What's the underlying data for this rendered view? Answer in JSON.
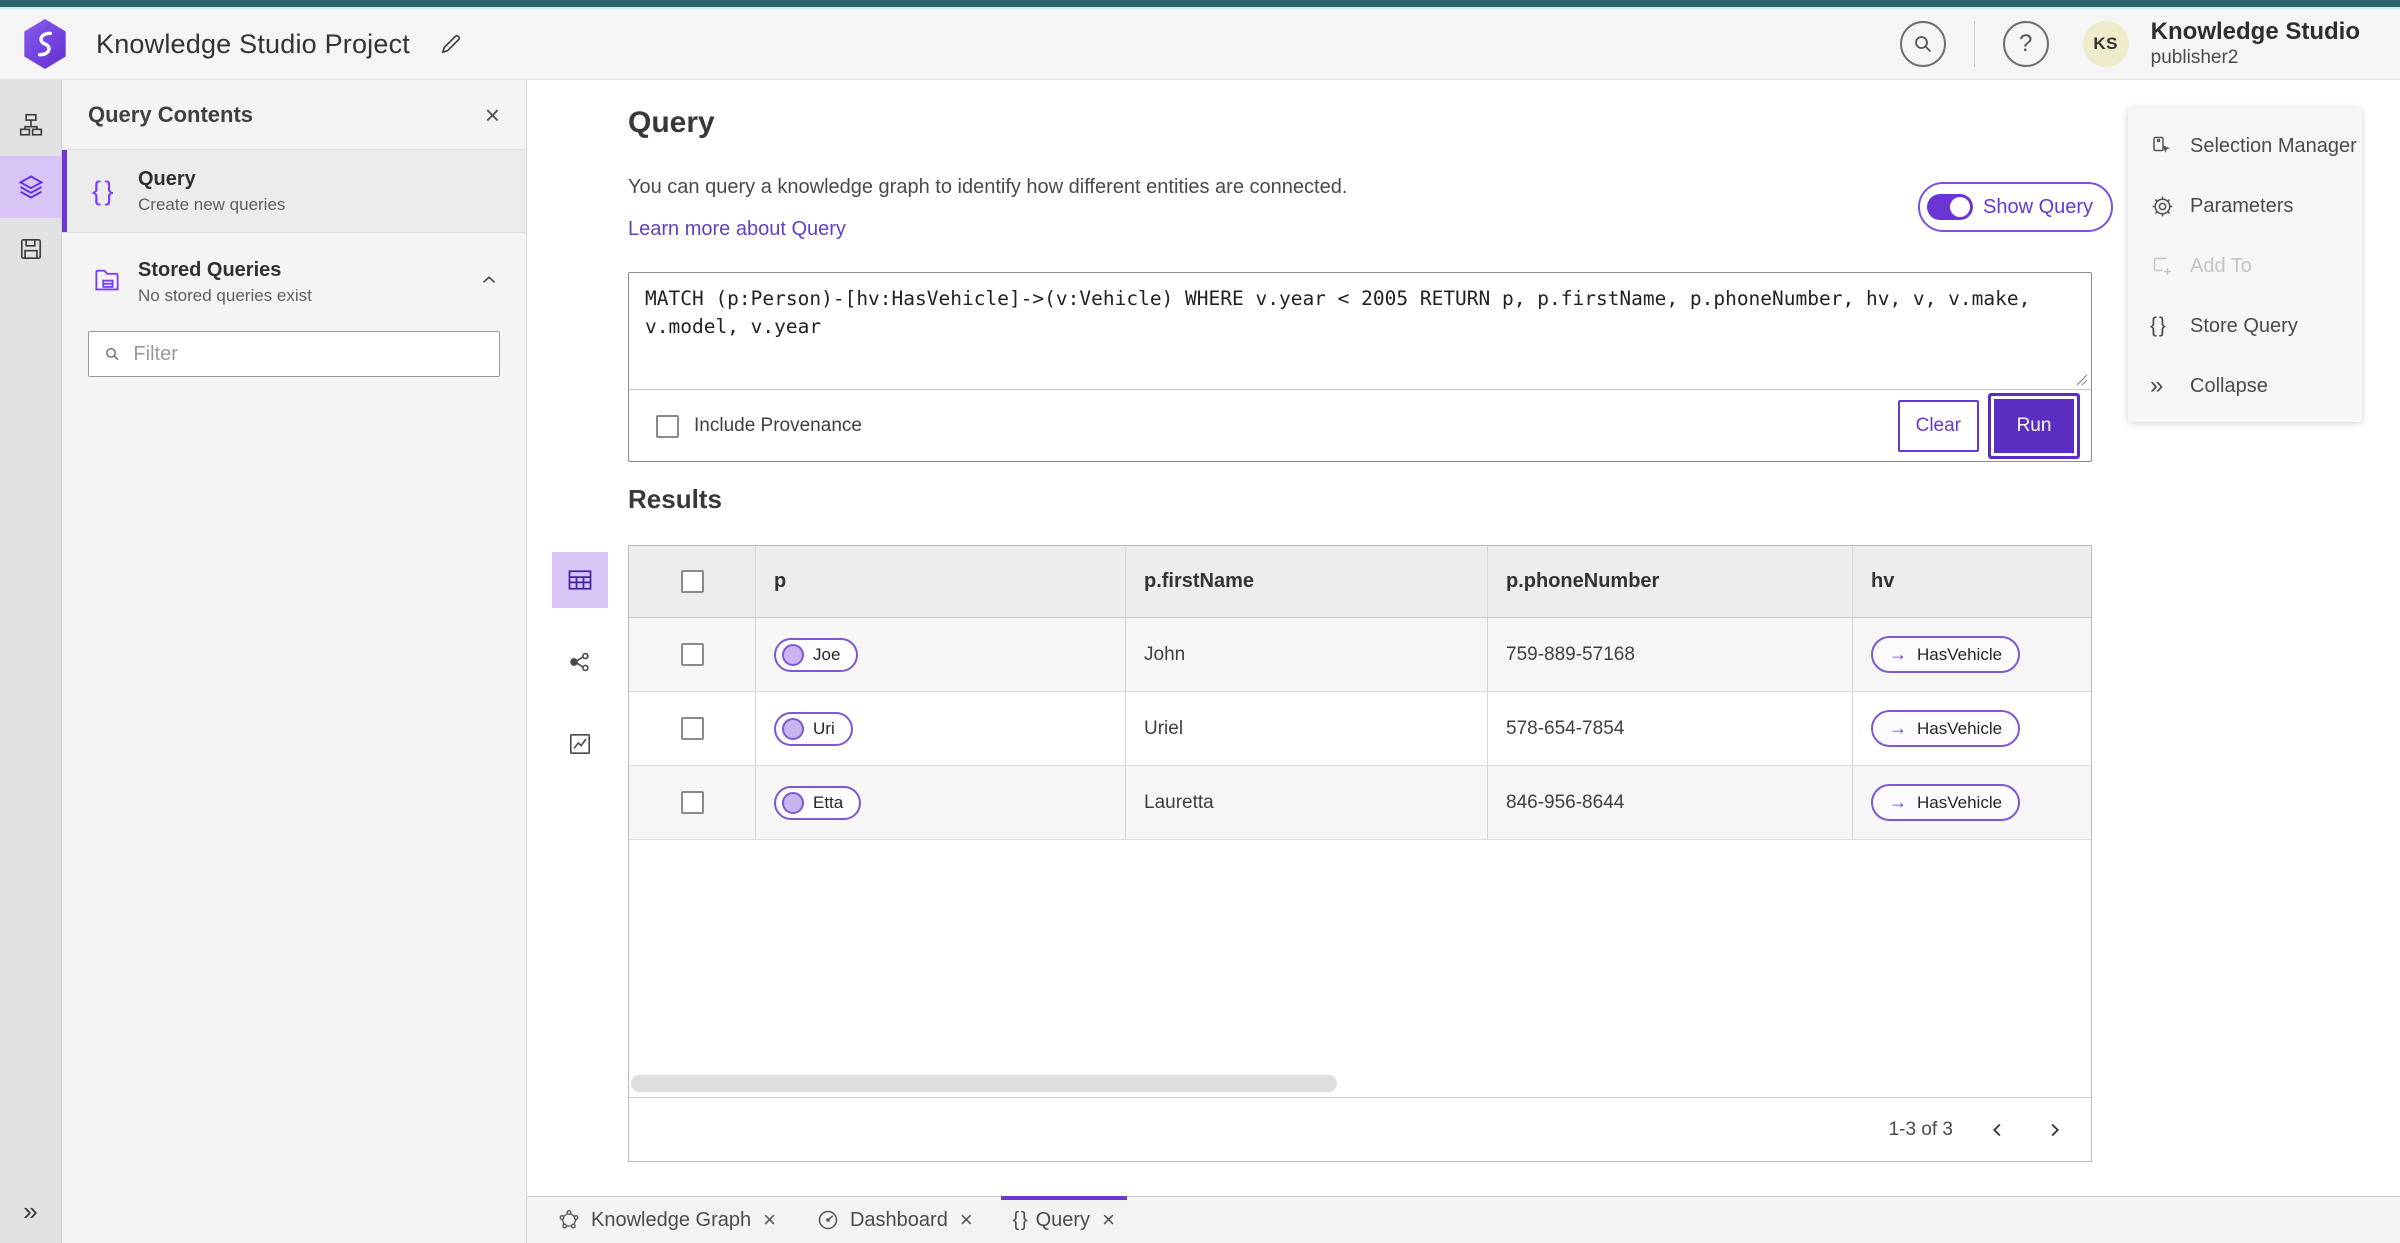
{
  "header": {
    "title": "Knowledge Studio Project",
    "user": {
      "initials": "KS",
      "name": "Knowledge Studio",
      "role": "publisher2"
    },
    "help_glyph": "?"
  },
  "sidebar": {
    "title": "Query Contents",
    "query_item": {
      "label": "Query",
      "description": "Create new queries"
    },
    "stored_item": {
      "label": "Stored Queries",
      "description": "No stored queries exist"
    },
    "filter_placeholder": "Filter"
  },
  "query": {
    "heading": "Query",
    "description": "You can query a knowledge graph to identify how different entities are connected.",
    "learn_more": "Learn more about Query",
    "show_query": "Show Query",
    "text": "MATCH (p:Person)-[hv:HasVehicle]->(v:Vehicle) WHERE v.year < 2005 RETURN p, p.firstName, p.phoneNumber, hv, v, v.make, v.model, v.year",
    "include_provenance": "Include Provenance",
    "clear": "Clear",
    "run": "Run"
  },
  "results": {
    "heading": "Results",
    "columns": [
      "p",
      "p.firstName",
      "p.phoneNumber",
      "hv"
    ],
    "rows": [
      {
        "p": "Joe",
        "firstName": "John",
        "phoneNumber": "759-889-57168",
        "hv": "HasVehicle"
      },
      {
        "p": "Uri",
        "firstName": "Uriel",
        "phoneNumber": "578-654-7854",
        "hv": "HasVehicle"
      },
      {
        "p": "Etta",
        "firstName": "Lauretta",
        "phoneNumber": "846-956-8644",
        "hv": "HasVehicle"
      }
    ],
    "pagination": "1-3 of 3"
  },
  "actions": {
    "items": [
      {
        "label": "Selection Manager"
      },
      {
        "label": "Parameters"
      },
      {
        "label": "Add To"
      },
      {
        "label": "Store Query"
      },
      {
        "label": "Collapse"
      }
    ]
  },
  "tabs": [
    {
      "label": "Knowledge Graph"
    },
    {
      "label": "Dashboard"
    },
    {
      "label": "Query"
    }
  ],
  "glyphs": {
    "close": "×",
    "braces": "{ }",
    "collapse": "»",
    "rail_expand": "»",
    "arrow_right": "→"
  },
  "colors": {
    "accent_purple": "#6a38d0",
    "run_button": "#5b2dc0",
    "teal_strip": "#2b666b",
    "rail_selected_bg": "#d8c5f6",
    "avatar_bg": "#eeeccb"
  }
}
